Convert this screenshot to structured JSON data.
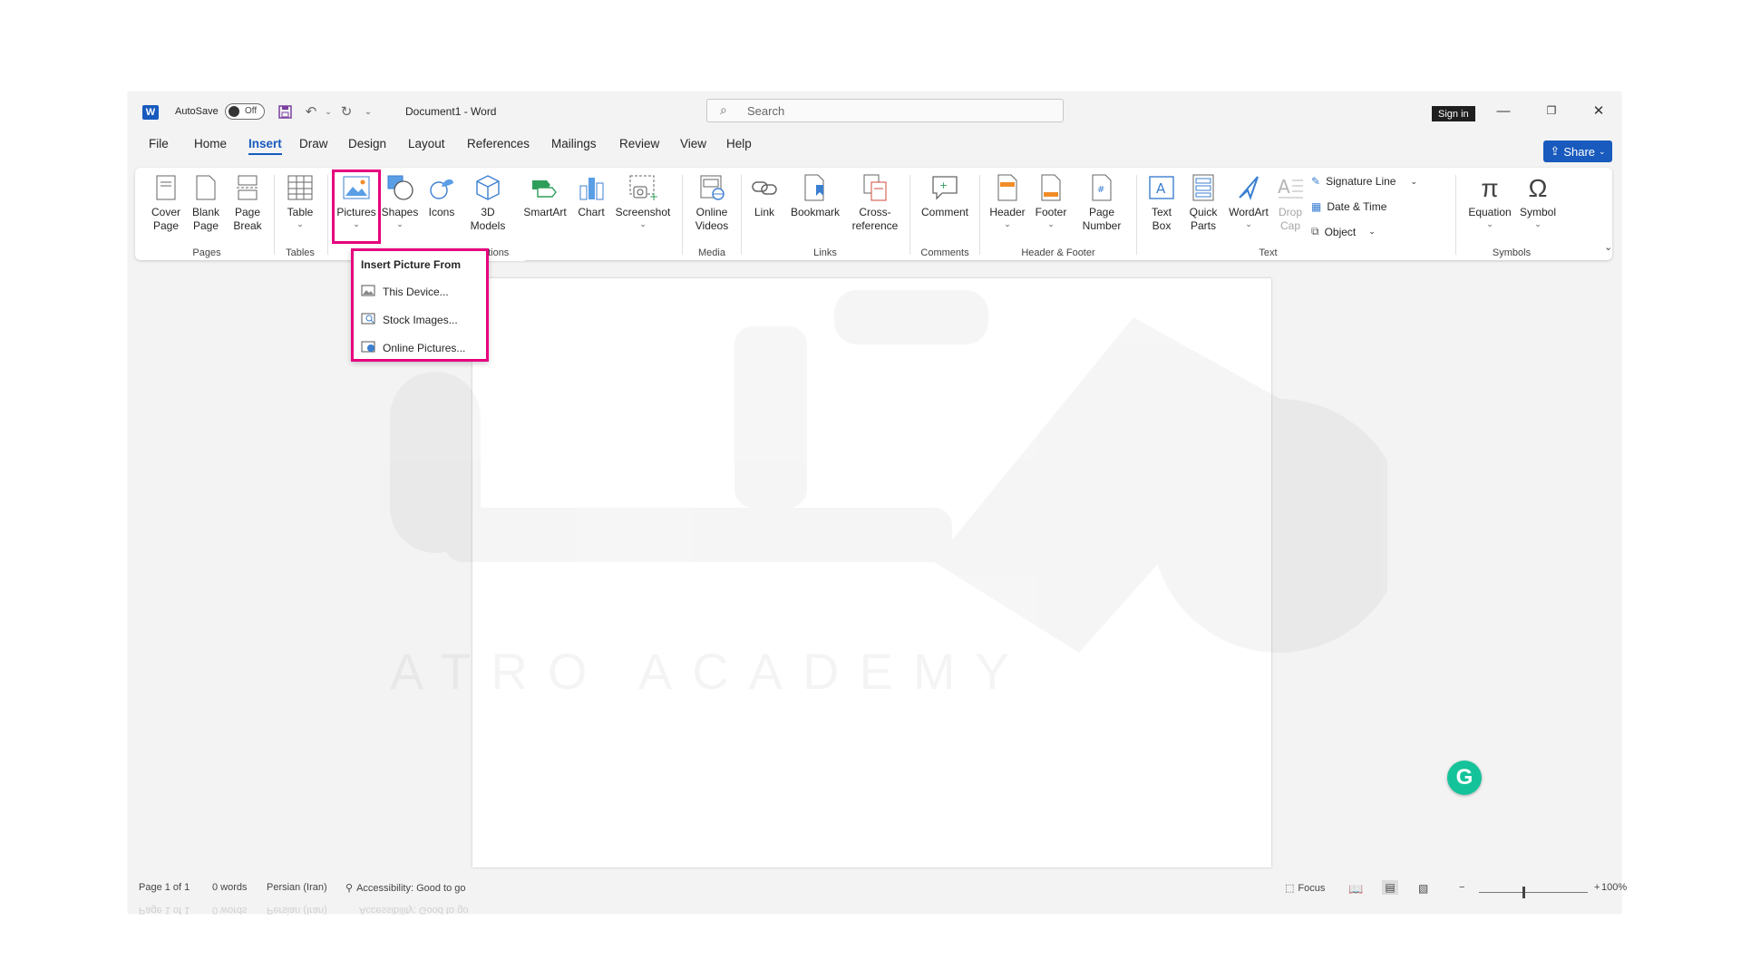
{
  "titlebar": {
    "autosave_label": "AutoSave",
    "autosave_state": "Off",
    "document_title": "Document1  -  Word",
    "search_placeholder": "Search",
    "signin_label": "Sign in"
  },
  "tabs": [
    "File",
    "Home",
    "Insert",
    "Draw",
    "Design",
    "Layout",
    "References",
    "Mailings",
    "Review",
    "View",
    "Help"
  ],
  "active_tab": "Insert",
  "share_label": "Share",
  "ribbon": {
    "pages": {
      "cover": "Cover",
      "cover2": "Page",
      "blank": "Blank",
      "blank2": "Page",
      "break": "Page",
      "break2": "Break",
      "group": "Pages"
    },
    "tables": {
      "table": "Table",
      "group": "Tables"
    },
    "illustrations": {
      "pictures": "Pictures",
      "shapes": "Shapes",
      "icons": "Icons",
      "models": "3D",
      "models2": "Models",
      "smartart": "SmartArt",
      "chart": "Chart",
      "screenshot": "Screenshot",
      "group": "Illustrations"
    },
    "media": {
      "online": "Online",
      "online2": "Videos",
      "group": "Media"
    },
    "links": {
      "link": "Link",
      "bookmark": "Bookmark",
      "cross": "Cross-",
      "cross2": "reference",
      "group": "Links"
    },
    "comments": {
      "comment": "Comment",
      "group": "Comments"
    },
    "header_footer": {
      "header": "Header",
      "footer": "Footer",
      "pagenum": "Page",
      "pagenum2": "Number",
      "group": "Header & Footer"
    },
    "text": {
      "textbox": "Text",
      "textbox2": "Box",
      "quick": "Quick",
      "quick2": "Parts",
      "wordart": "WordArt",
      "drop": "Drop",
      "drop2": "Cap",
      "signature": "Signature Line",
      "datetime": "Date & Time",
      "object": "Object",
      "group": "Text"
    },
    "symbols": {
      "equation": "Equation",
      "symbol": "Symbol",
      "group": "Symbols"
    }
  },
  "dropdown": {
    "header": "Insert Picture From",
    "items": [
      "This Device...",
      "Stock Images...",
      "Online Pictures..."
    ]
  },
  "status": {
    "page": "Page 1 of 1",
    "words": "0 words",
    "language": "Persian (Iran)",
    "accessibility": "Accessibility: Good to go",
    "focus": "Focus",
    "zoom": "100%"
  },
  "watermark_text": "ATRO ACADEMY",
  "colors": {
    "accent": "#185abd",
    "highlight": "#e6007e",
    "grammarly": "#15c39a"
  }
}
